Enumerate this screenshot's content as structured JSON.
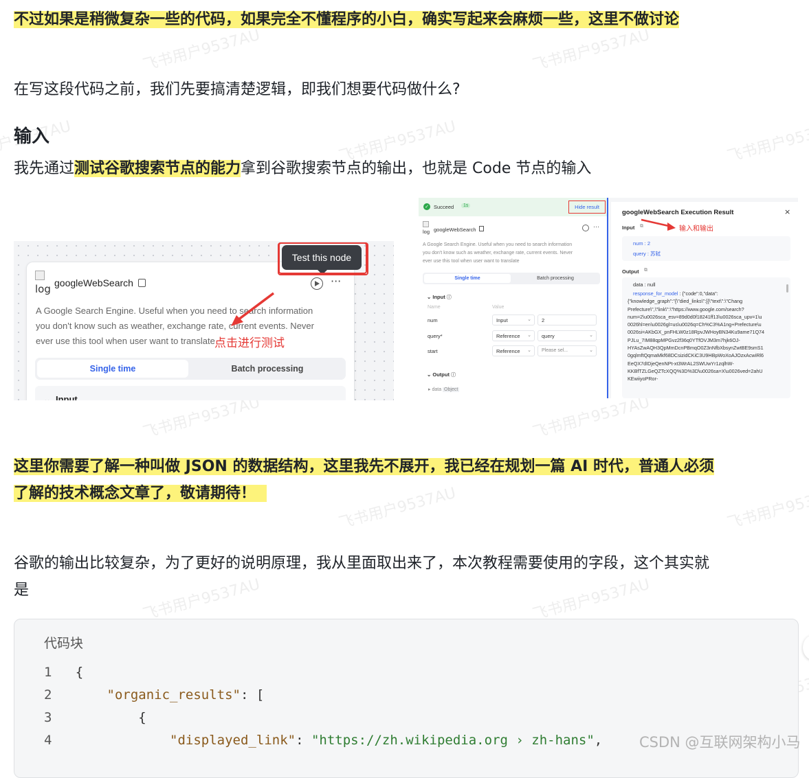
{
  "p1": "不过如果是稍微复杂一些的代码，如果完全不懂程序的小白，确实写起来会麻烦一些，这里不做讨论",
  "p2": "在写这段代码之前，我们先要搞清楚逻辑，即我们想要代码做什么?",
  "h_input": "输入",
  "p3_pre": "我先通过",
  "p3_hl": "测试谷歌搜索节点的能力",
  "p3_post": "拿到谷歌搜索节点的输出，也就是 Code 节点的输入",
  "left_shot": {
    "img_alt": "log",
    "node_name": "googleWebSearch",
    "tooltip": "Test this node",
    "desc1": "A Google Search Engine. Useful when you need to search information",
    "desc2": "you don't know such as weather, exchange rate, current events. Never",
    "desc3": "ever use this tool when user want to translate",
    "tab_single": "Single time",
    "tab_batch": "Batch processing",
    "input_label": "Input",
    "annotation": "点击进行测试"
  },
  "right_shot": {
    "status": "Succeed",
    "time": "1s",
    "hide_result": "Hide result",
    "img_alt": "log",
    "node_name": "googleWebSearch",
    "desc1": "A Google Search Engine. Useful when you need to search information",
    "desc2": "you don't know such as weather, exchange rate, current events. Never",
    "desc3": "ever use this tool when user want to translate",
    "tab_single": "Single time",
    "tab_batch": "Batch processing",
    "input_section": "Input",
    "col_name": "Name",
    "col_value": "Value",
    "rows": [
      {
        "name": "num",
        "type": "Input",
        "value": "2"
      },
      {
        "name": "query*",
        "type": "Reference",
        "value": "query"
      },
      {
        "name": "start",
        "type": "Reference",
        "value": "Please sel..."
      }
    ],
    "output_section": "Output",
    "out_data": "data",
    "out_type": "Object",
    "result_title": "googleWebSearch Execution Result",
    "result_input": "Input",
    "annotation": "输入和输出",
    "num_line": "num : 2",
    "query_line": "query : 苏轼",
    "result_output": "Output",
    "data_line": "data : null",
    "resp_key": "response_for_model",
    "resp_lines": [
      " : {\"code\":0,\"data\":",
      "{\"knowledge_graph\":\"{\\\"died_links\\\":[{\\\"text\\\":\\\"Chang",
      "Prefecture\\\",\\\"link\\\":\\\"https://www.google.com/search?",
      "num=2\\u0026sca_esv=89d0d0f18241ff13\\u0026sca_upv=1\\u",
      "0026hl=en\\u0026gl=us\\u0026q=Ch%C3%A1ng+Prefecture\\u",
      "0026si=AKbGX_pnFHLW0z18RpvJWHoyBN34Ku9ame71Q74",
      "PJLu_7IM88qpMPGvz2f36q0YTfOVJM3m7hjk6OJ-",
      "HYAsZwAQH3QpMmDcnPBmqO0Z3nNfbXbsynZwtBE9smS1",
      "0gqlmftQqmaMkf68DCsizidCKiC3U9HBpWoXoAJOzxAcwiRl6",
      "EeQX7dIDjeQenNPt-xt3WrAL2SWUwYr1zqlhW-",
      "KKBfTZLGeQZTcXQQ%3D%3D\\u0026sa=X\\u0026ved=2ahU",
      "KEwiiyoPRor-"
    ]
  },
  "p4_line1": "这里你需要了解一种叫做 JSON 的数据结构，这里我先不展开，我已经在规划一篇 AI 时代，普通人必须",
  "p4_line2": "了解的技术概念文章了，敬请期待！",
  "p5_line1": "谷歌的输出比较复杂，为了更好的说明原理，我从里面取出来了，本次教程需要使用的字段，这个其实就",
  "p5_line2": "是",
  "code": {
    "label": "代码块",
    "lines": [
      {
        "n": "1",
        "t": "{"
      },
      {
        "n": "2",
        "k": "\"organic_results\"",
        "t": ": ["
      },
      {
        "n": "3",
        "t": "{"
      },
      {
        "n": "4",
        "k": "\"displayed_link\"",
        "t": ": ",
        "s": "\"https://zh.wikipedia.org › zh-hans\"",
        "e": ","
      }
    ]
  },
  "watermark": "飞书用户9537AU",
  "csdn": "CSDN @互联网架构小马",
  "colors": {
    "highlight": "#fdf37b",
    "accent": "#3563e9",
    "annotation_red": "#e53935",
    "success": "#2ba84a"
  }
}
